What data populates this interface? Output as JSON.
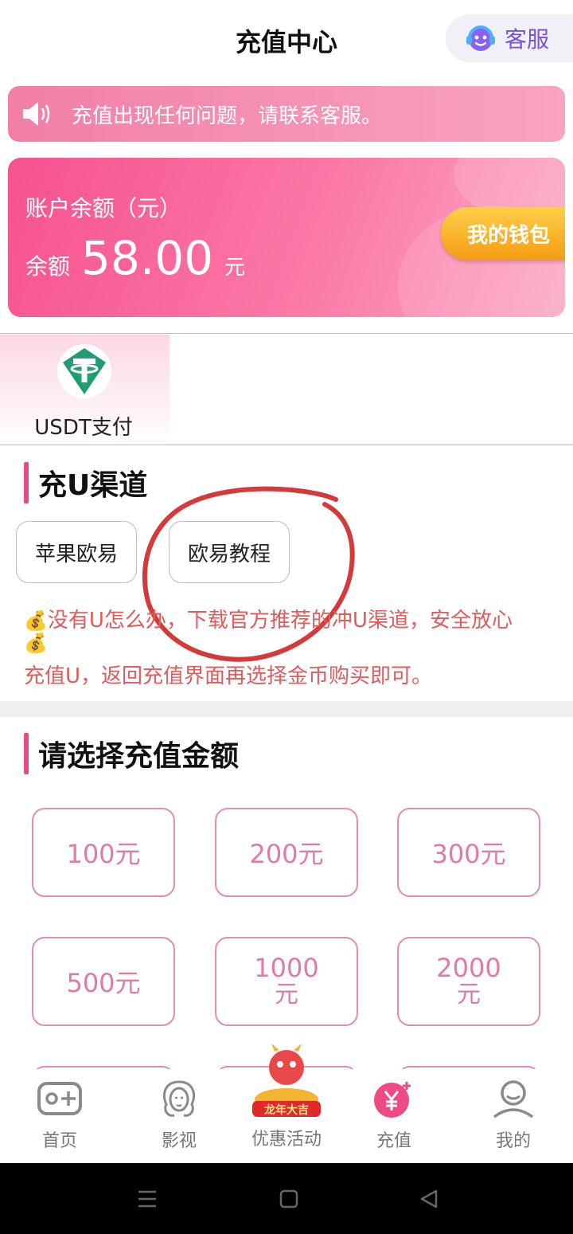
{
  "header": {
    "title": "充值中心",
    "customer_service": {
      "label": "客服",
      "icon": "headset-smiley-icon"
    }
  },
  "notice": {
    "icon": "speaker-icon",
    "text": "充值出现任何问题，请联系客服。"
  },
  "balance": {
    "label": "账户余额（元）",
    "prefix": "余额",
    "amount": "58.00",
    "unit": "元",
    "wallet_button": "我的钱包"
  },
  "payment_methods": [
    {
      "label": "USDT支付",
      "icon": "tether-usdt-icon",
      "selected": true
    }
  ],
  "channel_section": {
    "title": "充U渠道",
    "buttons": [
      {
        "label": "苹果欧易"
      },
      {
        "label": "欧易教程"
      }
    ],
    "tip_line1": "没有U怎么办，下载官方推荐的冲U渠道，安全放心",
    "tip_line2": "充值U，返回充值界面再选择金币购买即可。",
    "tip_icon": "money-bag-icon"
  },
  "amount_section": {
    "title": "请选择充值金额",
    "options": [
      {
        "value": "100",
        "unit": "元"
      },
      {
        "value": "200",
        "unit": "元"
      },
      {
        "value": "300",
        "unit": "元"
      },
      {
        "value": "500",
        "unit": "元"
      },
      {
        "value": "1000",
        "unit": "元"
      },
      {
        "value": "2000",
        "unit": "元"
      }
    ]
  },
  "tabbar": {
    "items": [
      {
        "label": "首页",
        "icon": "gamepad-icon",
        "active": false
      },
      {
        "label": "影视",
        "icon": "woman-face-icon",
        "active": false
      },
      {
        "label": "优惠活动",
        "icon": "dragon-promo-icon",
        "active": false,
        "badge_text": "龙年大吉"
      },
      {
        "label": "充值",
        "icon": "yen-coin-icon",
        "active": true
      },
      {
        "label": "我的",
        "icon": "user-icon",
        "active": false
      }
    ]
  },
  "colors": {
    "accent": "#e94a86",
    "card_gradient_start": "#f6528f",
    "wallet_button": "#f5a623",
    "amount_text": "#e07aa6",
    "tip_text": "#e35a5a"
  }
}
